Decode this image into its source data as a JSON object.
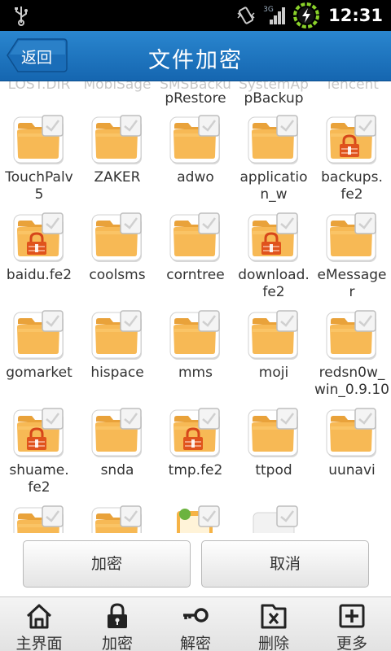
{
  "status_bar": {
    "time": "12:31",
    "network": "3G",
    "icons": [
      "usb-icon",
      "vibrate-icon",
      "signal-icon",
      "battery-charging-icon"
    ]
  },
  "header": {
    "back_label": "返回",
    "title": "文件加密"
  },
  "partial_top_row": {
    "faded_names": [
      "LOST.DIR",
      "MobiSage",
      "SMSBacku",
      "SystemAp",
      "Tencent"
    ],
    "second_lines": [
      "",
      "",
      "pRestore",
      "pBackup",
      ""
    ]
  },
  "files": [
    {
      "line1": "TouchPalv",
      "line2": "5",
      "locked": false
    },
    {
      "line1": "ZAKER",
      "line2": "",
      "locked": false
    },
    {
      "line1": "adwo",
      "line2": "",
      "locked": false
    },
    {
      "line1": "applicatio",
      "line2": "n_w",
      "locked": false
    },
    {
      "line1": "backups.",
      "line2": "fe2",
      "locked": true
    },
    {
      "line1": "baidu.fe2",
      "line2": "",
      "locked": true
    },
    {
      "line1": "coolsms",
      "line2": "",
      "locked": false
    },
    {
      "line1": "corntree",
      "line2": "",
      "locked": false
    },
    {
      "line1": "download.",
      "line2": "fe2",
      "locked": true
    },
    {
      "line1": "eMessage",
      "line2": "r",
      "locked": false
    },
    {
      "line1": "gomarket",
      "line2": "",
      "locked": false
    },
    {
      "line1": "hispace",
      "line2": "",
      "locked": false
    },
    {
      "line1": "mms",
      "line2": "",
      "locked": false
    },
    {
      "line1": "moji",
      "line2": "",
      "locked": false
    },
    {
      "line1": "redsn0w_",
      "line2": "win_0.9.10",
      "locked": false
    },
    {
      "line1": "shuame.",
      "line2": "fe2",
      "locked": true
    },
    {
      "line1": "snda",
      "line2": "",
      "locked": false
    },
    {
      "line1": "tmp.fe2",
      "line2": "",
      "locked": true
    },
    {
      "line1": "ttpod",
      "line2": "",
      "locked": false
    },
    {
      "line1": "uunavi",
      "line2": "",
      "locked": false
    }
  ],
  "partial_bottom_row": {
    "kinds": [
      "folder",
      "folder",
      "document",
      "blank-file"
    ]
  },
  "actions": {
    "encrypt_label": "加密",
    "cancel_label": "取消"
  },
  "toolbar": {
    "items": [
      {
        "label": "主界面",
        "icon": "home-icon"
      },
      {
        "label": "加密",
        "icon": "lock-icon"
      },
      {
        "label": "解密",
        "icon": "key-icon"
      },
      {
        "label": "删除",
        "icon": "trash-icon"
      },
      {
        "label": "更多",
        "icon": "plus-icon"
      }
    ]
  },
  "colors": {
    "title_bar": "#1e78c2",
    "folder": "#f5b24a",
    "lock": "#e0531c"
  }
}
